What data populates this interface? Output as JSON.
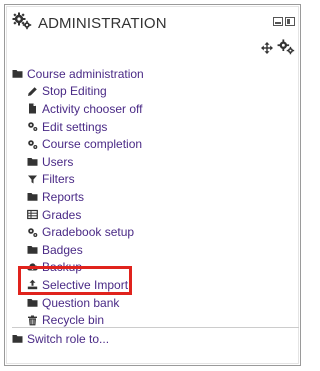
{
  "block": {
    "title": "ADMINISTRATION",
    "title_icon": "gears-icon",
    "controls": [
      "dock-icon",
      "hide-block-icon"
    ],
    "actions": [
      "move-icon",
      "gears-icon"
    ]
  },
  "tree": {
    "root": {
      "label": "Course administration",
      "icon": "folder-icon"
    },
    "items": [
      {
        "label": "Stop Editing",
        "icon": "pencil-icon"
      },
      {
        "label": "Activity chooser off",
        "icon": "file-icon"
      },
      {
        "label": "Edit settings",
        "icon": "gears-icon"
      },
      {
        "label": "Course completion",
        "icon": "gears-icon"
      },
      {
        "label": "Users",
        "icon": "folder-icon"
      },
      {
        "label": "Filters",
        "icon": "filter-icon"
      },
      {
        "label": "Reports",
        "icon": "folder-icon"
      },
      {
        "label": "Grades",
        "icon": "table-icon"
      },
      {
        "label": "Gradebook setup",
        "icon": "gears-icon"
      },
      {
        "label": "Badges",
        "icon": "folder-icon"
      },
      {
        "label": "Backup",
        "icon": "cloud-download-icon"
      },
      {
        "label": "Selective Import",
        "icon": "upload-icon"
      },
      {
        "label": "Question bank",
        "icon": "folder-icon"
      },
      {
        "label": "Recycle bin",
        "icon": "trash-icon"
      }
    ],
    "switch_role": {
      "label": "Switch role to...",
      "icon": "folder-icon"
    }
  },
  "colors": {
    "link": "#4a2a86",
    "highlight": "#e0231d",
    "icon": "#333333"
  }
}
